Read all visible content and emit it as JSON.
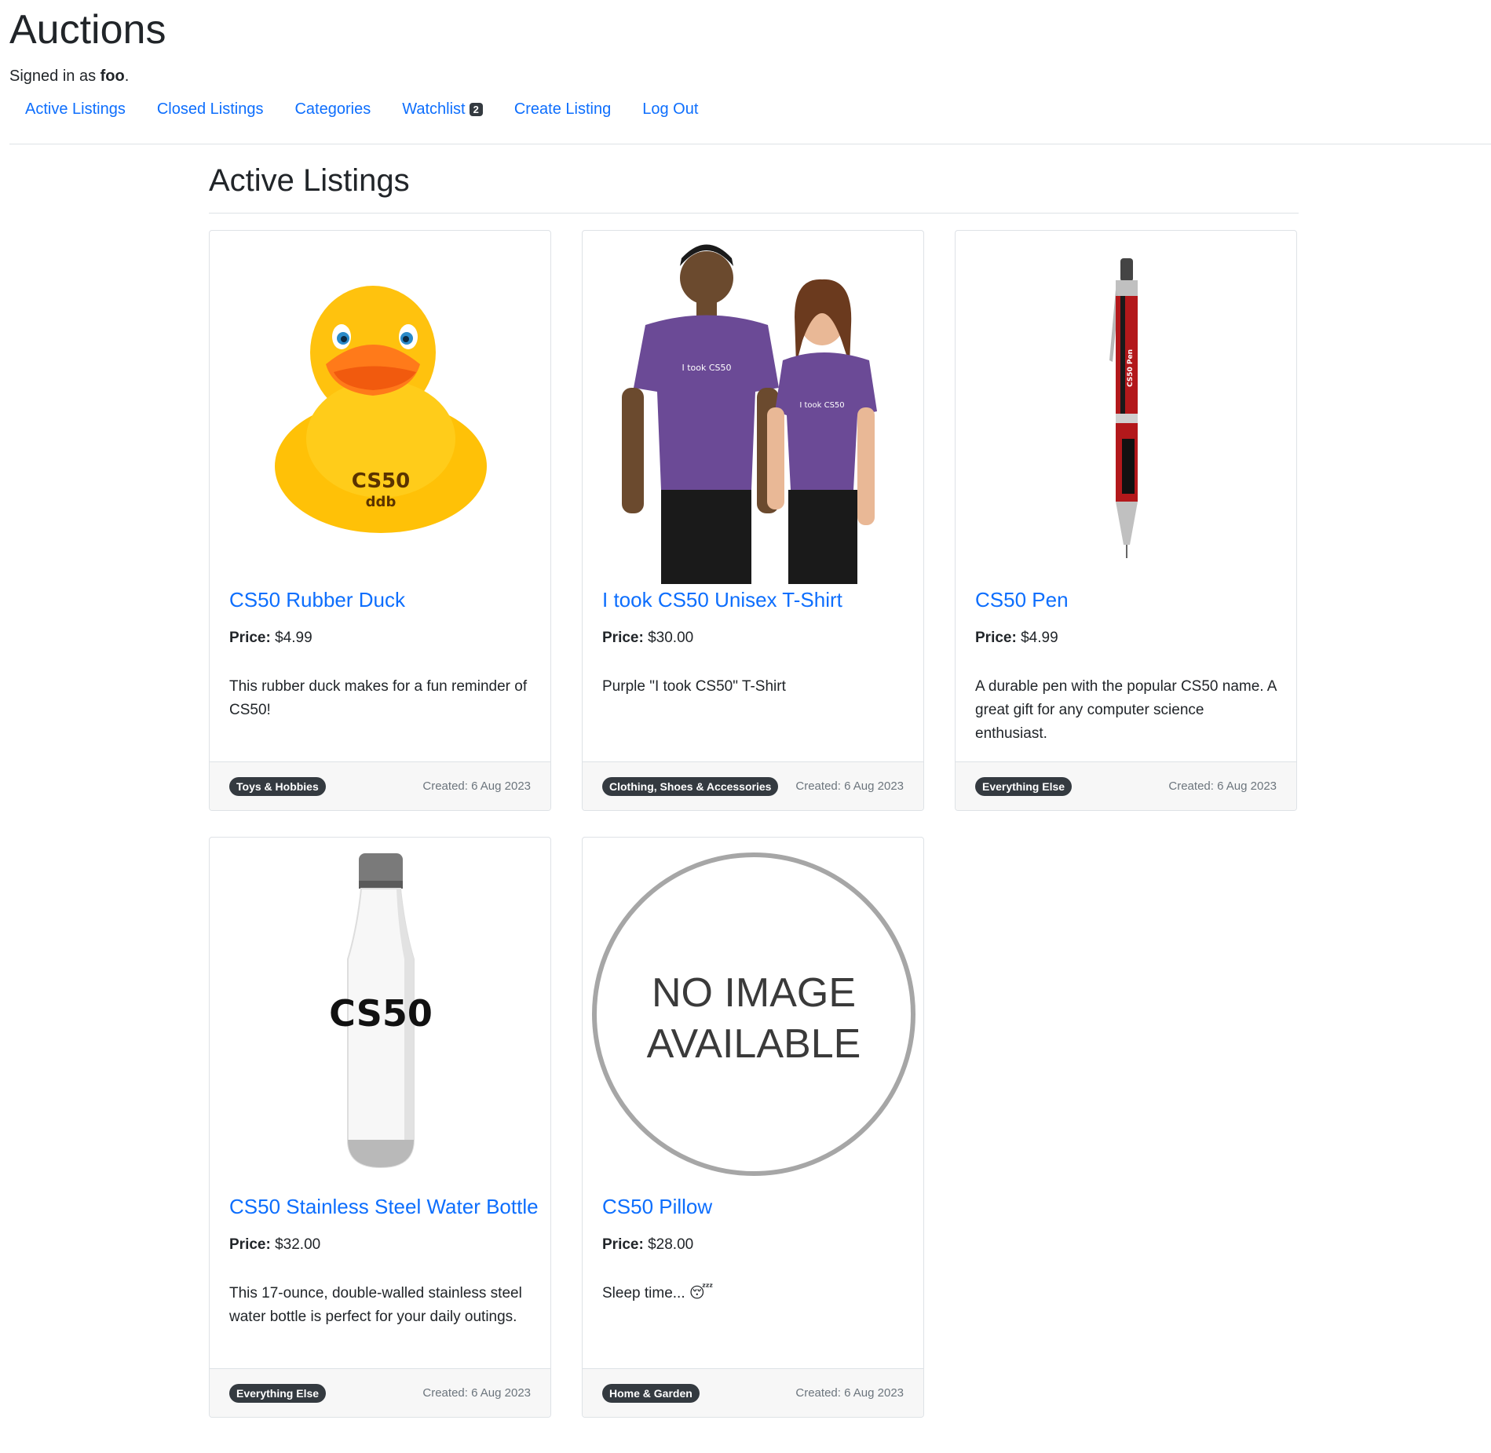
{
  "header": {
    "title": "Auctions",
    "signed_in_prefix": "Signed in as ",
    "username": "foo",
    "signed_in_suffix": "."
  },
  "nav": {
    "active_listings": "Active Listings",
    "closed_listings": "Closed Listings",
    "categories": "Categories",
    "watchlist": "Watchlist",
    "watchlist_count": "2",
    "create_listing": "Create Listing",
    "log_out": "Log Out"
  },
  "page": {
    "title": "Active Listings"
  },
  "price_label": "Price:",
  "listings": [
    {
      "title": "CS50 Rubber Duck",
      "price": "$4.99",
      "description": "This rubber duck makes for a fun reminder of CS50!",
      "category": "Toys & Hobbies",
      "created": "Created: 6 Aug 2023",
      "image": "rubber-duck-image",
      "image_text_1": "CS50",
      "image_text_2": "ddb"
    },
    {
      "title": "I took CS50 Unisex T-Shirt",
      "price": "$30.00",
      "description": "Purple \"I took CS50\" T-Shirt",
      "category": "Clothing, Shoes & Accessories",
      "created": "Created: 6 Aug 2023",
      "image": "tshirt-models-image",
      "image_text_1": "I took CS50",
      "image_text_2": "I took CS50"
    },
    {
      "title": "CS50 Pen",
      "price": "$4.99",
      "description": "A durable pen with the popular CS50 name. A great gift for any computer science enthusiast.",
      "category": "Everything Else",
      "created": "Created: 6 Aug 2023",
      "image": "pen-image",
      "image_text_1": "CS50 Pen"
    },
    {
      "title": "CS50 Stainless Steel Water Bottle",
      "price": "$32.00",
      "description": "This 17-ounce, double-walled stainless steel water bottle is perfect for your daily outings.",
      "category": "Everything Else",
      "created": "Created: 6 Aug 2023",
      "image": "water-bottle-image",
      "image_text_1": "CS50"
    },
    {
      "title": "CS50 Pillow",
      "price": "$28.00",
      "description": "Sleep time... 😴",
      "category": "Home & Garden",
      "created": "Created: 6 Aug 2023",
      "image": "no-image-placeholder",
      "image_text_1": "NO IMAGE",
      "image_text_2": "AVAILABLE"
    }
  ],
  "colors": {
    "link": "#0d6efd",
    "badge": "#343a40",
    "footer_bg": "#f7f7f7",
    "border": "#dee2e6",
    "duck": "#ffc107",
    "shirt": "#6b4a96",
    "pen": "#b3181b"
  }
}
